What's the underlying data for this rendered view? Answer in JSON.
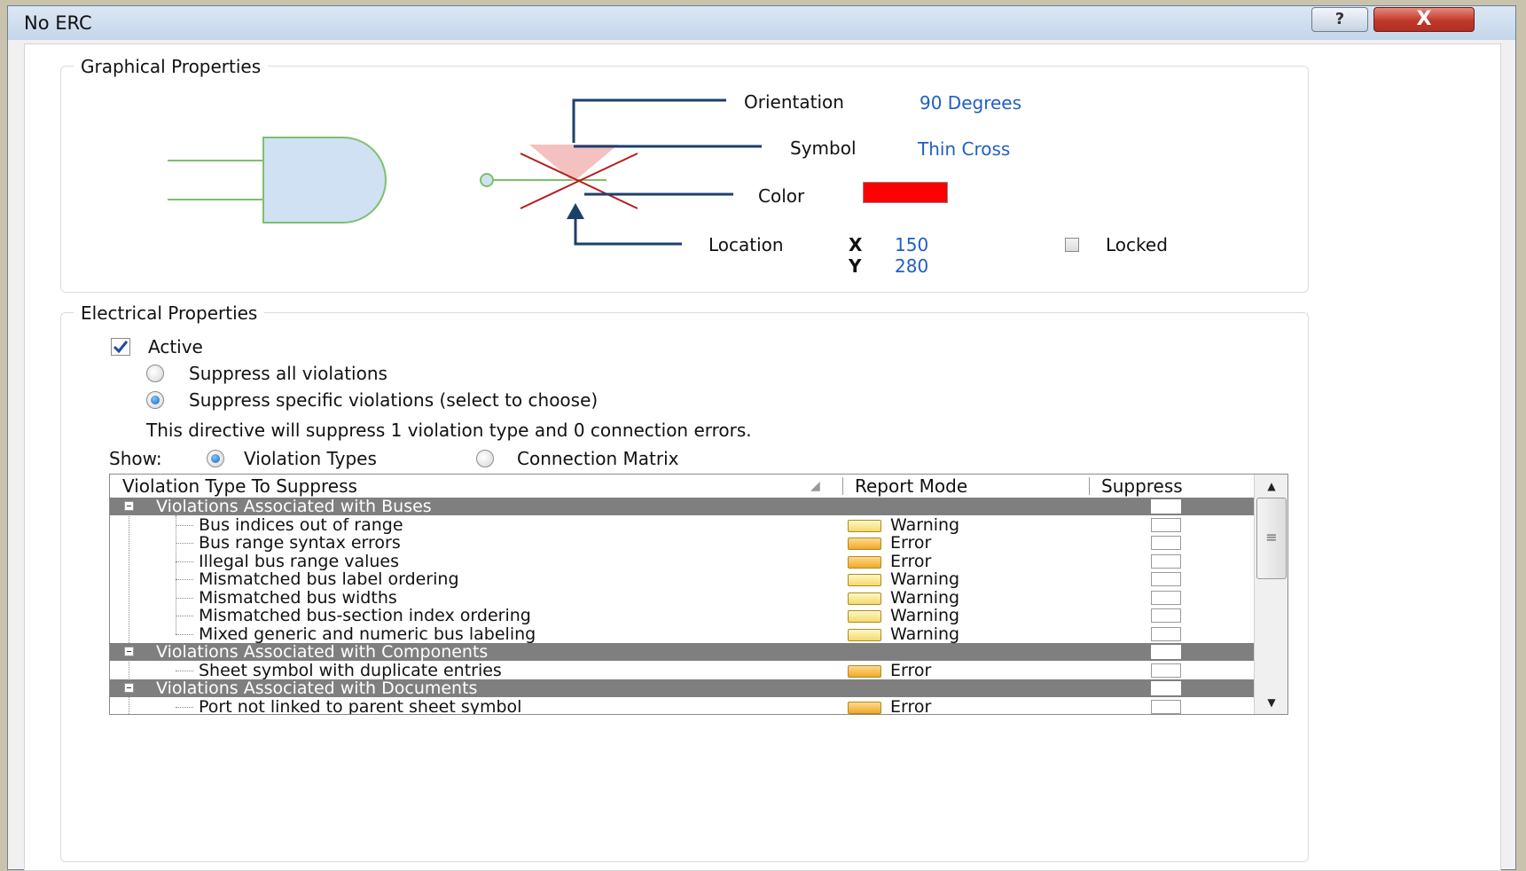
{
  "window": {
    "title": "No ERC",
    "help_glyph": "?",
    "close_glyph": "X"
  },
  "graphical": {
    "title": "Graphical Properties",
    "orientation_label": "Orientation",
    "orientation_value": "90 Degrees",
    "symbol_label": "Symbol",
    "symbol_value": "Thin Cross",
    "color_label": "Color",
    "color_value": "#ff0000",
    "location_label": "Location",
    "x_label": "X",
    "x_value": "150",
    "y_label": "Y",
    "y_value": "280",
    "locked_label": "Locked",
    "locked": false
  },
  "electrical": {
    "title": "Electrical Properties",
    "active_label": "Active",
    "active": true,
    "suppress_all_label": "Suppress all violations",
    "suppress_specific_label": "Suppress specific violations (select to choose)",
    "summary": "This directive will suppress 1 violation type and 0 connection errors.",
    "show_label": "Show:",
    "show_violation_types": "Violation Types",
    "show_connection_matrix": "Connection Matrix"
  },
  "table": {
    "columns": [
      "Violation Type To Suppress",
      "Report Mode",
      "Suppress"
    ],
    "groups": [
      {
        "label": "Violations Associated with Buses",
        "items": [
          {
            "name": "Bus indices out of range",
            "mode": "Warning"
          },
          {
            "name": "Bus range syntax errors",
            "mode": "Error"
          },
          {
            "name": "Illegal bus range values",
            "mode": "Error"
          },
          {
            "name": "Mismatched bus label ordering",
            "mode": "Warning"
          },
          {
            "name": "Mismatched bus widths",
            "mode": "Warning"
          },
          {
            "name": "Mismatched bus-section index ordering",
            "mode": "Warning"
          },
          {
            "name": "Mixed generic and numeric bus labeling",
            "mode": "Warning"
          }
        ]
      },
      {
        "label": "Violations Associated with Components",
        "items": [
          {
            "name": "Sheet symbol with duplicate entries",
            "mode": "Error"
          }
        ]
      },
      {
        "label": "Violations Associated with Documents",
        "items": [
          {
            "name": "Port not linked to parent sheet symbol",
            "mode": "Error"
          }
        ]
      }
    ]
  },
  "colors": {
    "accent_link": "#1f5fc4",
    "group_row_bg": "#7f7f7f",
    "gate_fill": "#cfe1f3",
    "gate_stroke": "#7dc06b",
    "cross": "#b71c1c"
  }
}
